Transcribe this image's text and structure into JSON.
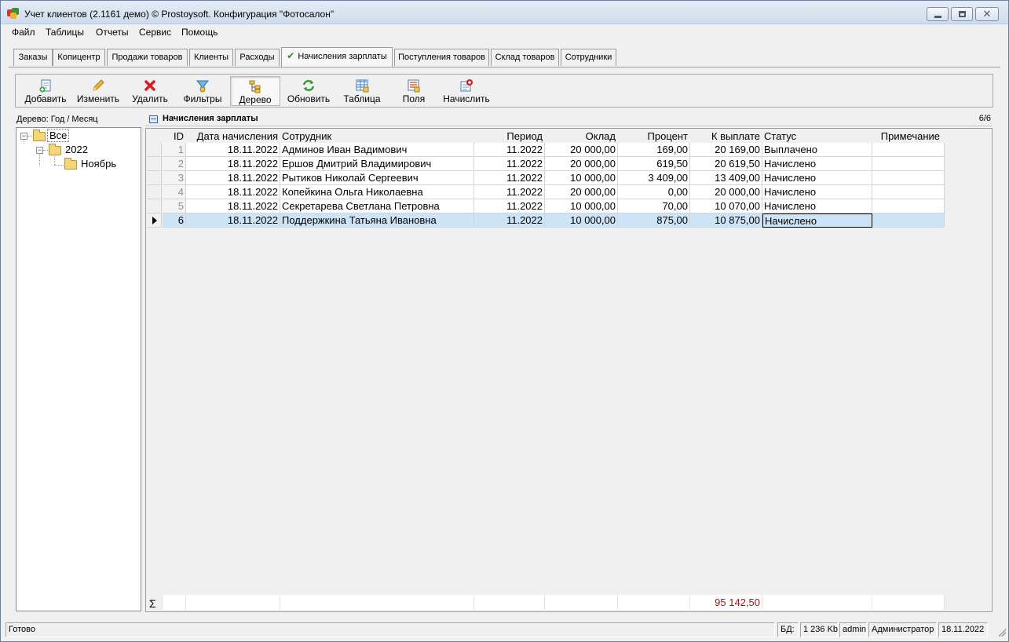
{
  "window": {
    "title": "Учет клиентов (2.1161 демо) © Prostoysoft. Конфигурация \"Фотосалон\""
  },
  "menu": [
    "Файл",
    "Таблицы",
    "Отчеты",
    "Сервис",
    "Помощь"
  ],
  "tabs": [
    {
      "label": "Заказы",
      "active": false
    },
    {
      "label": "Копицентр",
      "active": false
    },
    {
      "label": "Продажи товаров",
      "active": false
    },
    {
      "label": "Клиенты",
      "active": false
    },
    {
      "label": "Расходы",
      "active": false
    },
    {
      "label": "Начисления зарплаты",
      "active": true
    },
    {
      "label": "Поступления товаров",
      "active": false
    },
    {
      "label": "Склад товаров",
      "active": false
    },
    {
      "label": "Сотрудники",
      "active": false
    }
  ],
  "toolbar": [
    {
      "label": "Добавить",
      "icon": "add-icon"
    },
    {
      "label": "Изменить",
      "icon": "pencil-icon"
    },
    {
      "label": "Удалить",
      "icon": "delete-icon"
    },
    {
      "label": "Фильтры",
      "icon": "filter-icon"
    },
    {
      "label": "Дерево",
      "icon": "tree-icon",
      "pressed": true
    },
    {
      "label": "Обновить",
      "icon": "refresh-icon"
    },
    {
      "label": "Таблица",
      "icon": "table-icon"
    },
    {
      "label": "Поля",
      "icon": "fields-icon"
    },
    {
      "label": "Начислить",
      "icon": "accrue-icon"
    }
  ],
  "tree": {
    "caption": "Дерево: Год / Месяц",
    "nodes": [
      "Все",
      "2022",
      "Ноябрь"
    ]
  },
  "grid": {
    "title": "Начисления зарплаты",
    "count": "6/6",
    "columns": [
      "ID",
      "Дата начисления",
      "Сотрудник",
      "Период",
      "Оклад",
      "Процент",
      "К выплате",
      "Статус",
      "Примечание"
    ],
    "rows": [
      [
        "1",
        "18.11.2022",
        "Админов Иван Вадимович",
        "11.2022",
        "20 000,00",
        "169,00",
        "20 169,00",
        "Выплачено",
        ""
      ],
      [
        "2",
        "18.11.2022",
        "Ершов Дмитрий Владимирович",
        "11.2022",
        "20 000,00",
        "619,50",
        "20 619,50",
        "Начислено",
        ""
      ],
      [
        "3",
        "18.11.2022",
        "Рытиков Николай Сергеевич",
        "11.2022",
        "10 000,00",
        "3 409,00",
        "13 409,00",
        "Начислено",
        ""
      ],
      [
        "4",
        "18.11.2022",
        "Копейкина Ольга Николаевна",
        "11.2022",
        "20 000,00",
        "0,00",
        "20 000,00",
        "Начислено",
        ""
      ],
      [
        "5",
        "18.11.2022",
        "Секретарева Светлана Петровна",
        "11.2022",
        "10 000,00",
        "70,00",
        "10 070,00",
        "Начислено",
        ""
      ],
      [
        "6",
        "18.11.2022",
        "Поддержкина Татьяна Ивановна",
        "11.2022",
        "10 000,00",
        "875,00",
        "10 875,00",
        "Начислено",
        ""
      ]
    ],
    "selected_row": 6,
    "sum_symbol": "Σ",
    "total": "95 142,50"
  },
  "status": {
    "text": "Готово",
    "db_label": "БД:",
    "db_size": "1 236 Kb",
    "user": "admin",
    "role": "Администратор",
    "date": "18.11.2022"
  },
  "colors": {
    "selected_row": "#cde3f7",
    "total_text": "#a0151a",
    "active_tab_check": "#2e8a27"
  }
}
